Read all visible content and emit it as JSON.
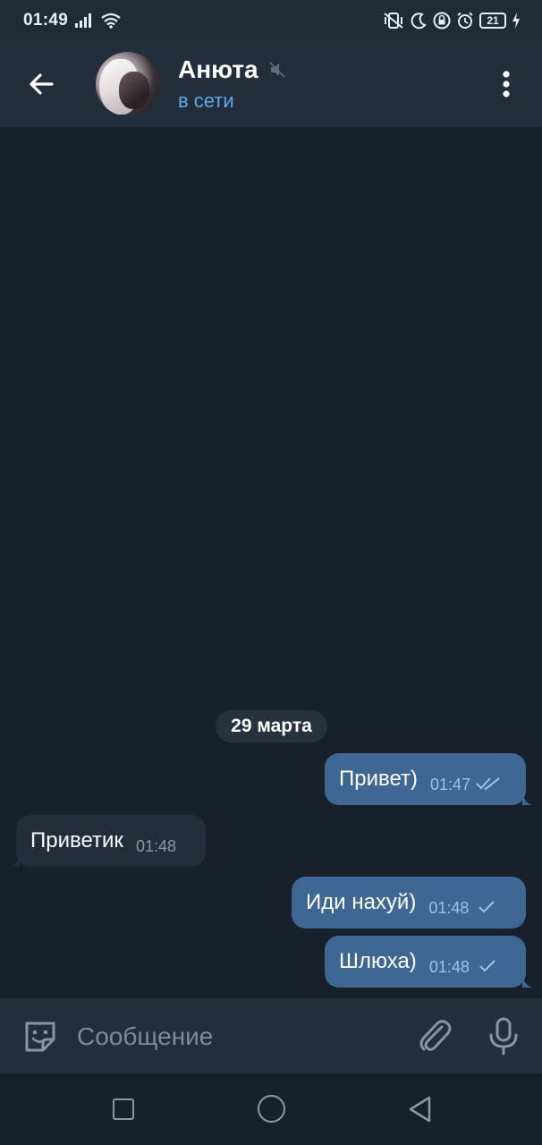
{
  "status_bar": {
    "time": "01:49",
    "battery": "21"
  },
  "header": {
    "title": "Анюта⁠",
    "status": "в сети"
  },
  "chat": {
    "date_separator": "29 марта",
    "messages": [
      {
        "direction": "out",
        "text": "Привет)",
        "time": "01:47",
        "read": true
      },
      {
        "direction": "in",
        "text": "Приветик",
        "time": "01:48"
      },
      {
        "direction": "out",
        "text": "Иди нахуй)",
        "time": "01:48",
        "read": false
      },
      {
        "direction": "out",
        "text": "Шлюха)",
        "time": "01:48",
        "read": false
      }
    ]
  },
  "input": {
    "placeholder": "Сообщение",
    "value": ""
  },
  "colors": {
    "background": "#18202b",
    "header": "#232e3c",
    "outgoing_bubble": "#3e6794",
    "incoming_bubble": "#232e3c",
    "accent": "#5fa8e6"
  },
  "icons": [
    "back-arrow-icon",
    "muted-speaker-icon",
    "more-vertical-icon",
    "double-check-icon",
    "single-check-icon",
    "sticker-icon",
    "paperclip-icon",
    "microphone-icon"
  ]
}
